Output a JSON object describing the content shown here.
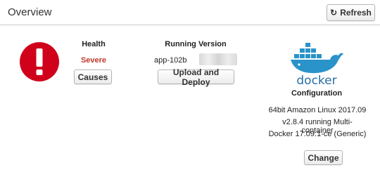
{
  "header": {
    "title": "Overview",
    "refresh_label": "Refresh",
    "refresh_icon": "refresh-icon"
  },
  "health": {
    "label": "Health",
    "status": "Severe",
    "status_color": "#c0392b",
    "causes_label": "Causes",
    "icon": "alert-circle-icon",
    "icon_color": "#d0021b"
  },
  "version": {
    "label": "Running Version",
    "value": "app-102b",
    "upload_label": "Upload and Deploy"
  },
  "configuration": {
    "logo": "docker-logo",
    "logo_text": "docker",
    "label": "Configuration",
    "line1": "64bit Amazon Linux 2017.09",
    "line2": "v2.8.4 running Multi-container",
    "line3": "Docker 17.09.1-ce (Generic)",
    "change_label": "Change"
  }
}
